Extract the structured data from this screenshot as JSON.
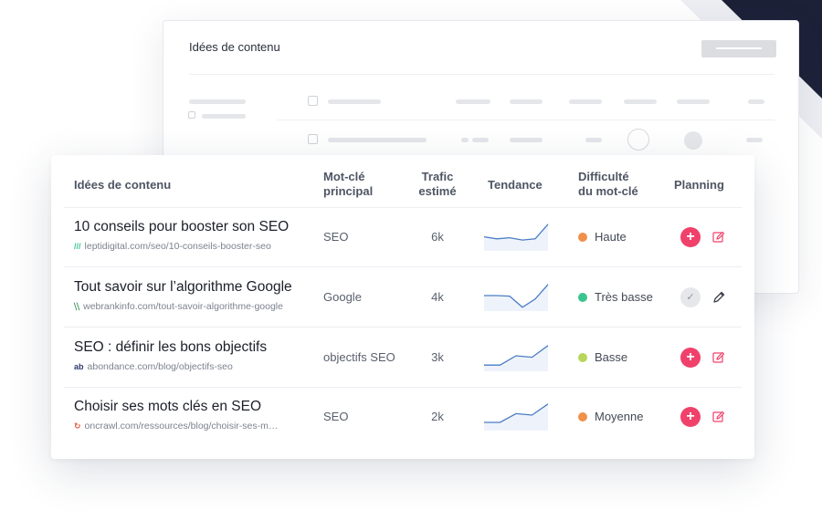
{
  "back_card": {
    "title": "Idées de contenu"
  },
  "table": {
    "headers": {
      "idea": "Idées de contenu",
      "keyword_l1": "Mot-clé",
      "keyword_l2": "principal",
      "traffic_l1": "Trafic",
      "traffic_l2": "estimé",
      "trend": "Tendance",
      "difficulty_l1": "Difficulté",
      "difficulty_l2": "du mot-clé",
      "planning": "Planning"
    },
    "rows": [
      {
        "title": "10 conseils pour booster son SEO",
        "favicon": "///",
        "url": "leptidigital.com/seo/10-conseils-booster-seo",
        "keyword": "SEO",
        "traffic": "6k",
        "difficulty": "Haute",
        "difficulty_color": "#f0904a",
        "trend": [
          0.55,
          0.62,
          0.58,
          0.66,
          0.62,
          0.12
        ],
        "planned": false
      },
      {
        "title": "Tout savoir sur l’algorithme Google",
        "favicon": "⧹⧹",
        "url": "webrankinfo.com/tout-savoir-algorithme-google",
        "keyword": "Google",
        "traffic": "4k",
        "difficulty": "Très basse",
        "difficulty_color": "#3cc48f",
        "trend": [
          0.5,
          0.5,
          0.52,
          0.9,
          0.62,
          0.12
        ],
        "planned": true
      },
      {
        "title": "SEO : définir les bons objectifs",
        "favicon": "ab",
        "url": "abondance.com/blog/objectifs-seo",
        "keyword": "objectifs SEO",
        "traffic": "3k",
        "difficulty": "Basse",
        "difficulty_color": "#b8d65a",
        "trend": [
          0.82,
          0.82,
          0.5,
          0.55,
          0.15
        ],
        "planned": false
      },
      {
        "title": "Choisir ses mots clés en SEO",
        "favicon": "↻",
        "url": "oncrawl.com/ressources/blog/choisir-ses-m…",
        "keyword": "SEO",
        "traffic": "2k",
        "difficulty": "Moyenne",
        "difficulty_color": "#f0904a",
        "trend": [
          0.75,
          0.75,
          0.45,
          0.5,
          0.12
        ],
        "planned": false
      }
    ]
  },
  "colors": {
    "accent": "#f0416b",
    "trend_line": "#4a7cc4",
    "trend_fill": "#eef3fb"
  },
  "icons": {
    "add": "plus-icon",
    "done": "check-icon",
    "edit": "edit-icon"
  }
}
